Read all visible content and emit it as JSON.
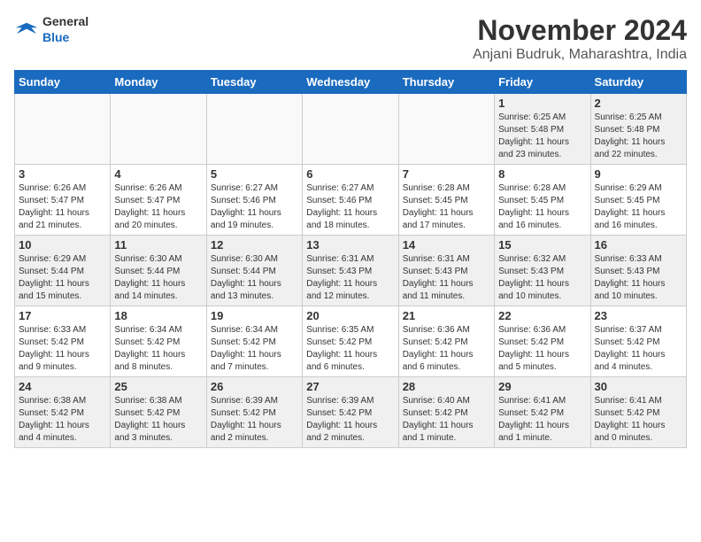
{
  "header": {
    "logo_general": "General",
    "logo_blue": "Blue",
    "month": "November 2024",
    "location": "Anjani Budruk, Maharashtra, India"
  },
  "weekdays": [
    "Sunday",
    "Monday",
    "Tuesday",
    "Wednesday",
    "Thursday",
    "Friday",
    "Saturday"
  ],
  "weeks": [
    [
      {
        "day": "",
        "info": ""
      },
      {
        "day": "",
        "info": ""
      },
      {
        "day": "",
        "info": ""
      },
      {
        "day": "",
        "info": ""
      },
      {
        "day": "",
        "info": ""
      },
      {
        "day": "1",
        "info": "Sunrise: 6:25 AM\nSunset: 5:48 PM\nDaylight: 11 hours\nand 23 minutes."
      },
      {
        "day": "2",
        "info": "Sunrise: 6:25 AM\nSunset: 5:48 PM\nDaylight: 11 hours\nand 22 minutes."
      }
    ],
    [
      {
        "day": "3",
        "info": "Sunrise: 6:26 AM\nSunset: 5:47 PM\nDaylight: 11 hours\nand 21 minutes."
      },
      {
        "day": "4",
        "info": "Sunrise: 6:26 AM\nSunset: 5:47 PM\nDaylight: 11 hours\nand 20 minutes."
      },
      {
        "day": "5",
        "info": "Sunrise: 6:27 AM\nSunset: 5:46 PM\nDaylight: 11 hours\nand 19 minutes."
      },
      {
        "day": "6",
        "info": "Sunrise: 6:27 AM\nSunset: 5:46 PM\nDaylight: 11 hours\nand 18 minutes."
      },
      {
        "day": "7",
        "info": "Sunrise: 6:28 AM\nSunset: 5:45 PM\nDaylight: 11 hours\nand 17 minutes."
      },
      {
        "day": "8",
        "info": "Sunrise: 6:28 AM\nSunset: 5:45 PM\nDaylight: 11 hours\nand 16 minutes."
      },
      {
        "day": "9",
        "info": "Sunrise: 6:29 AM\nSunset: 5:45 PM\nDaylight: 11 hours\nand 16 minutes."
      }
    ],
    [
      {
        "day": "10",
        "info": "Sunrise: 6:29 AM\nSunset: 5:44 PM\nDaylight: 11 hours\nand 15 minutes."
      },
      {
        "day": "11",
        "info": "Sunrise: 6:30 AM\nSunset: 5:44 PM\nDaylight: 11 hours\nand 14 minutes."
      },
      {
        "day": "12",
        "info": "Sunrise: 6:30 AM\nSunset: 5:44 PM\nDaylight: 11 hours\nand 13 minutes."
      },
      {
        "day": "13",
        "info": "Sunrise: 6:31 AM\nSunset: 5:43 PM\nDaylight: 11 hours\nand 12 minutes."
      },
      {
        "day": "14",
        "info": "Sunrise: 6:31 AM\nSunset: 5:43 PM\nDaylight: 11 hours\nand 11 minutes."
      },
      {
        "day": "15",
        "info": "Sunrise: 6:32 AM\nSunset: 5:43 PM\nDaylight: 11 hours\nand 10 minutes."
      },
      {
        "day": "16",
        "info": "Sunrise: 6:33 AM\nSunset: 5:43 PM\nDaylight: 11 hours\nand 10 minutes."
      }
    ],
    [
      {
        "day": "17",
        "info": "Sunrise: 6:33 AM\nSunset: 5:42 PM\nDaylight: 11 hours\nand 9 minutes."
      },
      {
        "day": "18",
        "info": "Sunrise: 6:34 AM\nSunset: 5:42 PM\nDaylight: 11 hours\nand 8 minutes."
      },
      {
        "day": "19",
        "info": "Sunrise: 6:34 AM\nSunset: 5:42 PM\nDaylight: 11 hours\nand 7 minutes."
      },
      {
        "day": "20",
        "info": "Sunrise: 6:35 AM\nSunset: 5:42 PM\nDaylight: 11 hours\nand 6 minutes."
      },
      {
        "day": "21",
        "info": "Sunrise: 6:36 AM\nSunset: 5:42 PM\nDaylight: 11 hours\nand 6 minutes."
      },
      {
        "day": "22",
        "info": "Sunrise: 6:36 AM\nSunset: 5:42 PM\nDaylight: 11 hours\nand 5 minutes."
      },
      {
        "day": "23",
        "info": "Sunrise: 6:37 AM\nSunset: 5:42 PM\nDaylight: 11 hours\nand 4 minutes."
      }
    ],
    [
      {
        "day": "24",
        "info": "Sunrise: 6:38 AM\nSunset: 5:42 PM\nDaylight: 11 hours\nand 4 minutes."
      },
      {
        "day": "25",
        "info": "Sunrise: 6:38 AM\nSunset: 5:42 PM\nDaylight: 11 hours\nand 3 minutes."
      },
      {
        "day": "26",
        "info": "Sunrise: 6:39 AM\nSunset: 5:42 PM\nDaylight: 11 hours\nand 2 minutes."
      },
      {
        "day": "27",
        "info": "Sunrise: 6:39 AM\nSunset: 5:42 PM\nDaylight: 11 hours\nand 2 minutes."
      },
      {
        "day": "28",
        "info": "Sunrise: 6:40 AM\nSunset: 5:42 PM\nDaylight: 11 hours\nand 1 minute."
      },
      {
        "day": "29",
        "info": "Sunrise: 6:41 AM\nSunset: 5:42 PM\nDaylight: 11 hours\nand 1 minute."
      },
      {
        "day": "30",
        "info": "Sunrise: 6:41 AM\nSunset: 5:42 PM\nDaylight: 11 hours\nand 0 minutes."
      }
    ]
  ]
}
